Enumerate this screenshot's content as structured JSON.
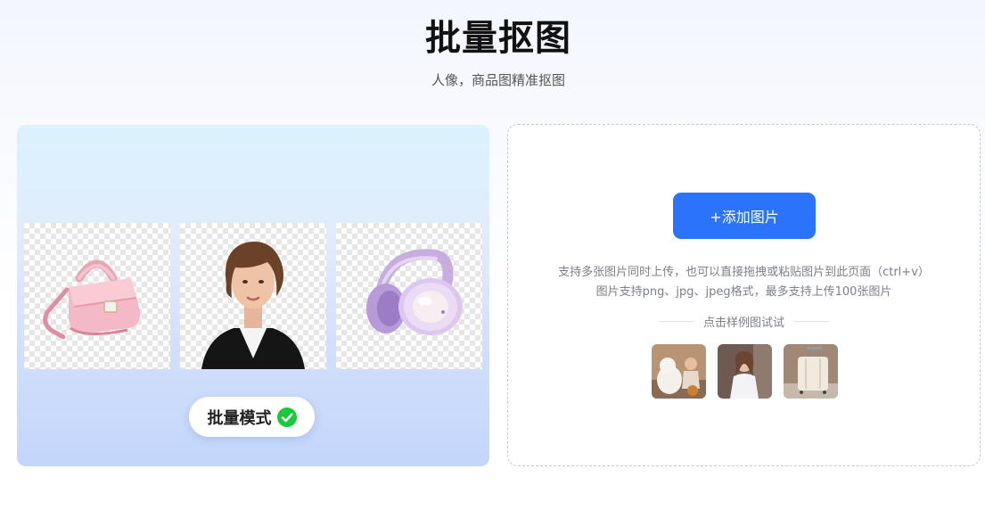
{
  "header": {
    "title": "批量抠图",
    "subtitle": "人像，商品图精准抠图"
  },
  "showcase": {
    "mode_label": "批量模式",
    "tiles": [
      {
        "icon": "pink-handbag-image"
      },
      {
        "icon": "woman-portrait-image"
      },
      {
        "icon": "purple-headphones-image"
      }
    ],
    "check_color": "#1ac93a"
  },
  "upload": {
    "add_button": "+添加图片",
    "hint_line1": "支持多张图片同时上传，也可以直接拖拽或粘贴图片到此页面（ctrl+v）",
    "hint_line2": "图片支持png、jpg、jpeg格式，最多支持上传100张图片",
    "samples_label": "点击样例图试试",
    "sample_thumbs": [
      {
        "icon": "child-with-dog-image"
      },
      {
        "icon": "woman-white-shirt-image"
      },
      {
        "icon": "white-suitcase-image"
      }
    ],
    "accent_color": "#2b73fb"
  }
}
